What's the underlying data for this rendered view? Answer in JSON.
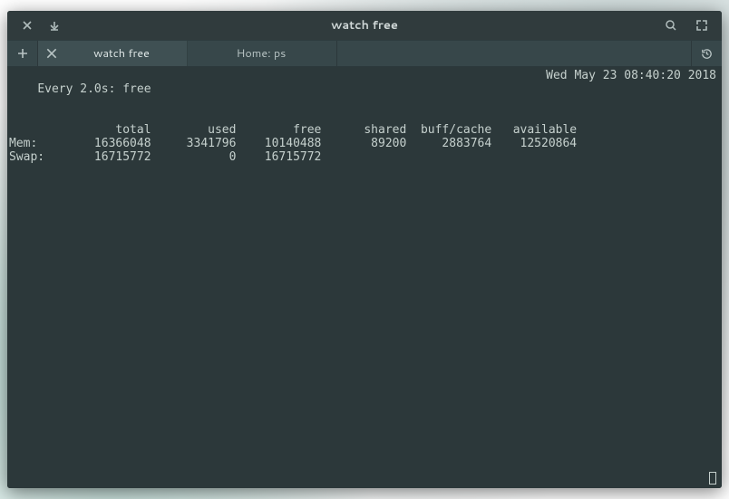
{
  "window": {
    "title": "watch free"
  },
  "tabs": [
    {
      "label": "watch free",
      "active": true
    },
    {
      "label": "Home: ps",
      "active": false
    }
  ],
  "terminal": {
    "watch_prefix": "Every 2.0s: free",
    "timestamp": "Wed May 23 08:40:20 2018",
    "columns": [
      "total",
      "used",
      "free",
      "shared",
      "buff/cache",
      "available"
    ],
    "rows": [
      {
        "label": "Mem:",
        "values": [
          "16366048",
          "3341796",
          "10140488",
          "89200",
          "2883764",
          "12520864"
        ]
      },
      {
        "label": "Swap:",
        "values": [
          "16715772",
          "0",
          "16715772",
          "",
          "",
          ""
        ]
      }
    ]
  }
}
